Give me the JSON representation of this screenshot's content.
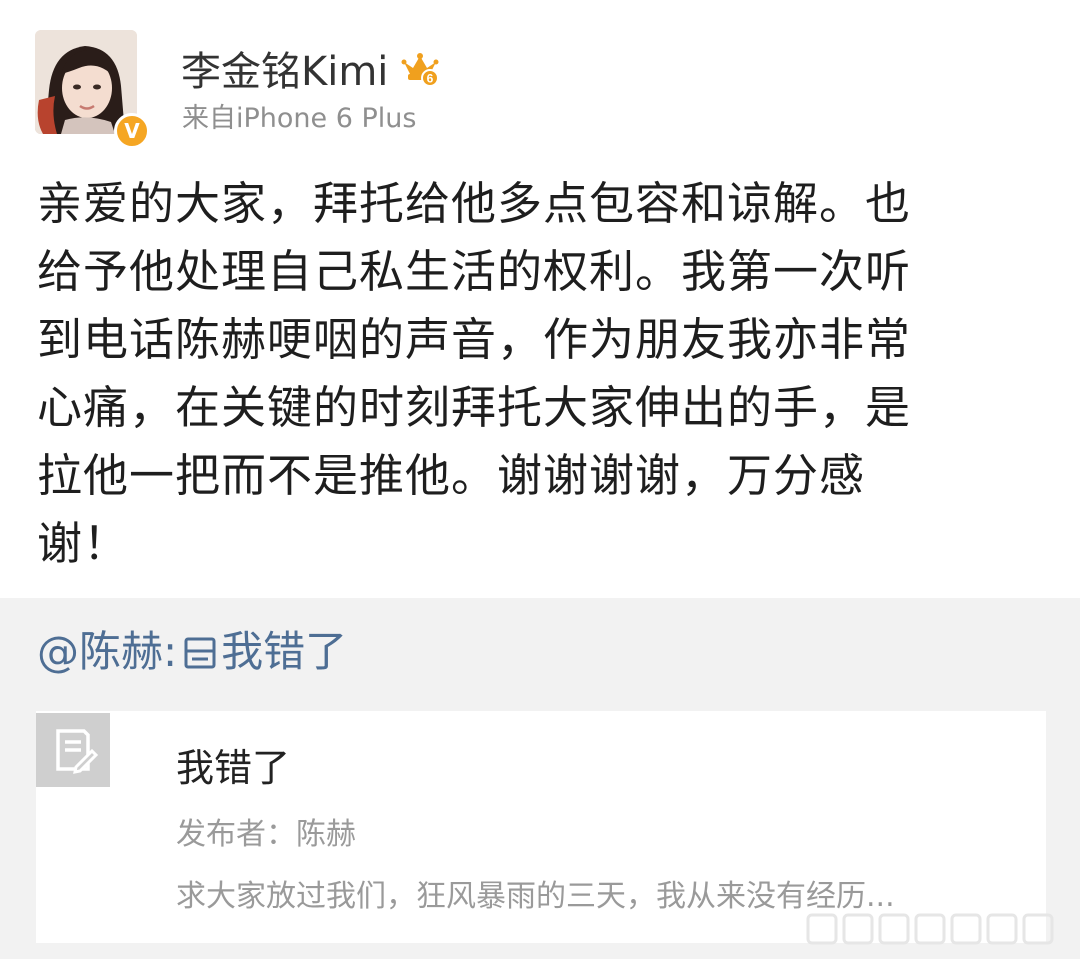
{
  "post": {
    "username": "李金铭Kimi",
    "source": "来自iPhone 6 Plus",
    "verified_badge": "V",
    "vip_level": "6",
    "text_lines": [
      "亲爱的大家，拜托给他多点包容和谅解。也",
      "给予他处理自己私生活的权利。我第一次听",
      "到电话陈赫哽咽的声音，作为朋友我亦非常",
      "心痛，在关键的时刻拜托大家伸出的手，是",
      "拉他一把而不是推他。谢谢谢谢，万分感",
      "谢！"
    ]
  },
  "repost": {
    "mention": "@陈赫:",
    "text": "我错了",
    "card": {
      "title": "我错了",
      "author": "发布者：陈赫",
      "description": "求大家放过我们，狂风暴雨的三天，我从来没有经历..."
    }
  },
  "icons": {
    "avatar": "avatar-photo",
    "vip": "crown-vip-icon",
    "verified": "verified-badge-icon",
    "article": "article-icon"
  },
  "colors": {
    "mention": "#4e6e94",
    "badge": "#f5a623",
    "repost_bg": "#f2f2f2"
  }
}
